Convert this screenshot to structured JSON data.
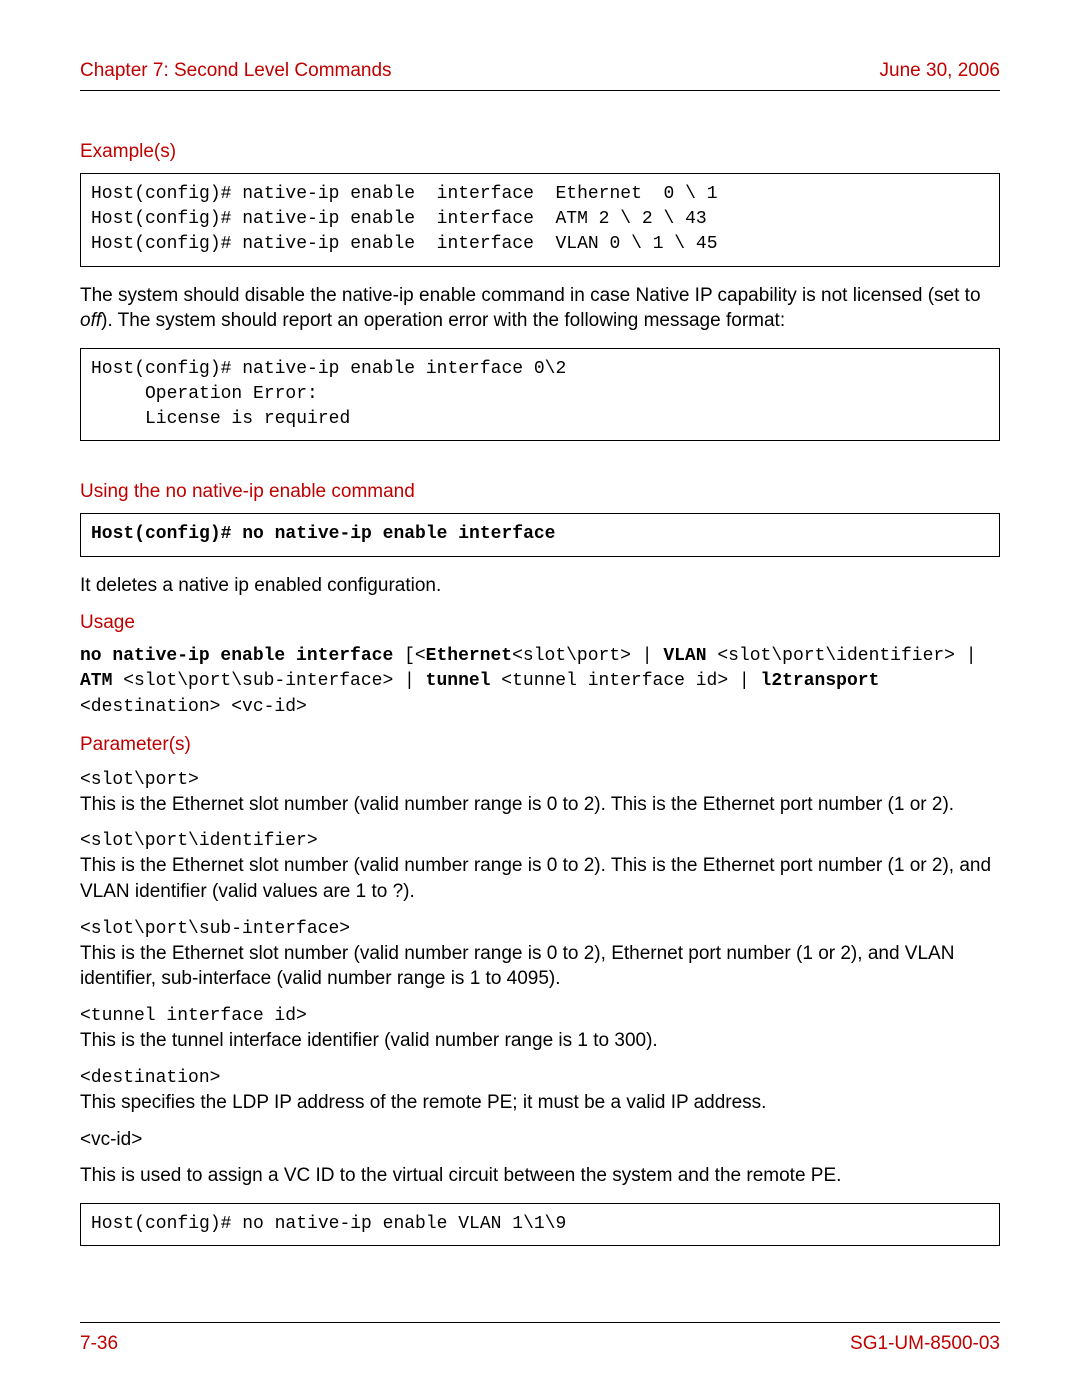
{
  "header": {
    "chapter": "Chapter 7: Second Level Commands",
    "date": "June 30, 2006"
  },
  "sections": {
    "examples_title": "Example(s)",
    "examples_code": "Host(config)# native-ip enable  interface  Ethernet  0 \\ 1\nHost(config)# native-ip enable  interface  ATM 2 \\ 2 \\ 43\nHost(config)# native-ip enable  interface  VLAN 0 \\ 1 \\ 45",
    "disable_text_pre": "The system should disable the native-ip enable command in case Native IP capability is not licensed (set to ",
    "disable_text_italic": "off",
    "disable_text_post": "). The system should report an operation error with the following message format:",
    "error_code": "Host(config)# native-ip enable interface 0\\2\n     Operation Error:\n     License is required",
    "no_cmd_title": "Using the no native-ip enable command",
    "no_cmd_code": "Host(config)# no native-ip enable interface",
    "no_cmd_desc": "It deletes a native ip enabled configuration.",
    "usage_title": "Usage",
    "usage": {
      "p1b": "no native-ip enable interface",
      "p1": " [<",
      "p2b": "Ethernet",
      "p2": "<slot\\port> | ",
      "p3b": "VLAN",
      "p3": " <slot\\port\\identifier>  | ",
      "p4b": "ATM",
      "p4": " <slot\\port\\sub-interface>  | ",
      "p5b": "tunnel",
      "p5": " <tunnel interface id> | ",
      "p6b": "l2transport",
      "p6": " <destination> <vc-id>"
    },
    "params_title": "Parameter(s)",
    "params": [
      {
        "name": "<slot\\port>",
        "mono": true,
        "desc": "This is the Ethernet slot number (valid number range is 0 to 2). This is the Ethernet port number (1 or 2)."
      },
      {
        "name": "<slot\\port\\identifier>",
        "mono": true,
        "desc": "This is the Ethernet slot number (valid number range is 0 to 2). This is the Ethernet port number (1 or 2), and VLAN identifier (valid values are 1 to ?)."
      },
      {
        "name": "<slot\\port\\sub-interface>",
        "mono": true,
        "desc": "This is the Ethernet slot number (valid number range is 0 to 2), Ethernet port number (1 or 2), and VLAN identifier, sub-interface (valid number range is 1 to 4095)."
      },
      {
        "name": "<tunnel interface id>",
        "mono": true,
        "desc": "This is the tunnel interface identifier (valid number range is 1 to 300)."
      },
      {
        "name": "<destination>",
        "mono": true,
        "desc": "This specifies the LDP IP address of the remote PE; it must be a valid IP address."
      },
      {
        "name": "<vc-id>",
        "mono": false,
        "desc": "This is used to assign a VC ID to the virtual circuit between the system and the remote PE."
      }
    ],
    "final_code": "Host(config)# no native-ip enable VLAN 1\\1\\9"
  },
  "footer": {
    "page": "7-36",
    "doc": "SG1-UM-8500-03"
  }
}
